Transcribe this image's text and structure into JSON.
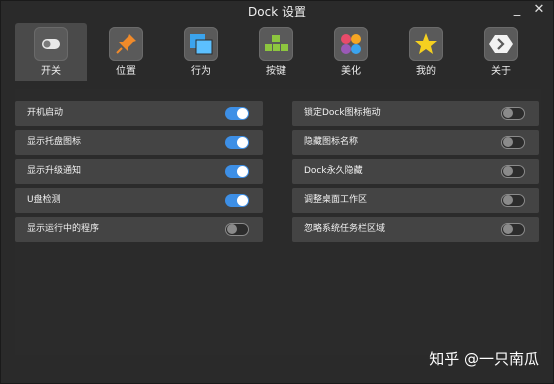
{
  "window": {
    "title": "Dock 设置"
  },
  "tabs": [
    {
      "label": "开关",
      "icon": "toggle-icon"
    },
    {
      "label": "位置",
      "icon": "pin-icon"
    },
    {
      "label": "行为",
      "icon": "windows-icon"
    },
    {
      "label": "按键",
      "icon": "keys-icon"
    },
    {
      "label": "美化",
      "icon": "palette-icon"
    },
    {
      "label": "我的",
      "icon": "star-icon"
    },
    {
      "label": "关于",
      "icon": "hexagon-icon"
    }
  ],
  "settings": {
    "left": [
      {
        "label": "开机启动",
        "on": true
      },
      {
        "label": "显示托盘图标",
        "on": true
      },
      {
        "label": "显示升级通知",
        "on": true
      },
      {
        "label": "U盘检测",
        "on": true
      },
      {
        "label": "显示运行中的程序",
        "on": false
      }
    ],
    "right": [
      {
        "label": "锁定Dock图标拖动",
        "on": false
      },
      {
        "label": "隐藏图标名称",
        "on": false
      },
      {
        "label": "Dock永久隐藏",
        "on": false
      },
      {
        "label": "调整桌面工作区",
        "on": false
      },
      {
        "label": "忽略系统任务栏区域",
        "on": false
      }
    ]
  },
  "watermark": "知乎 @一只南瓜",
  "colors": {
    "accent": "#3d8fe6",
    "background": "#2a2a2a",
    "row": "#444444"
  }
}
